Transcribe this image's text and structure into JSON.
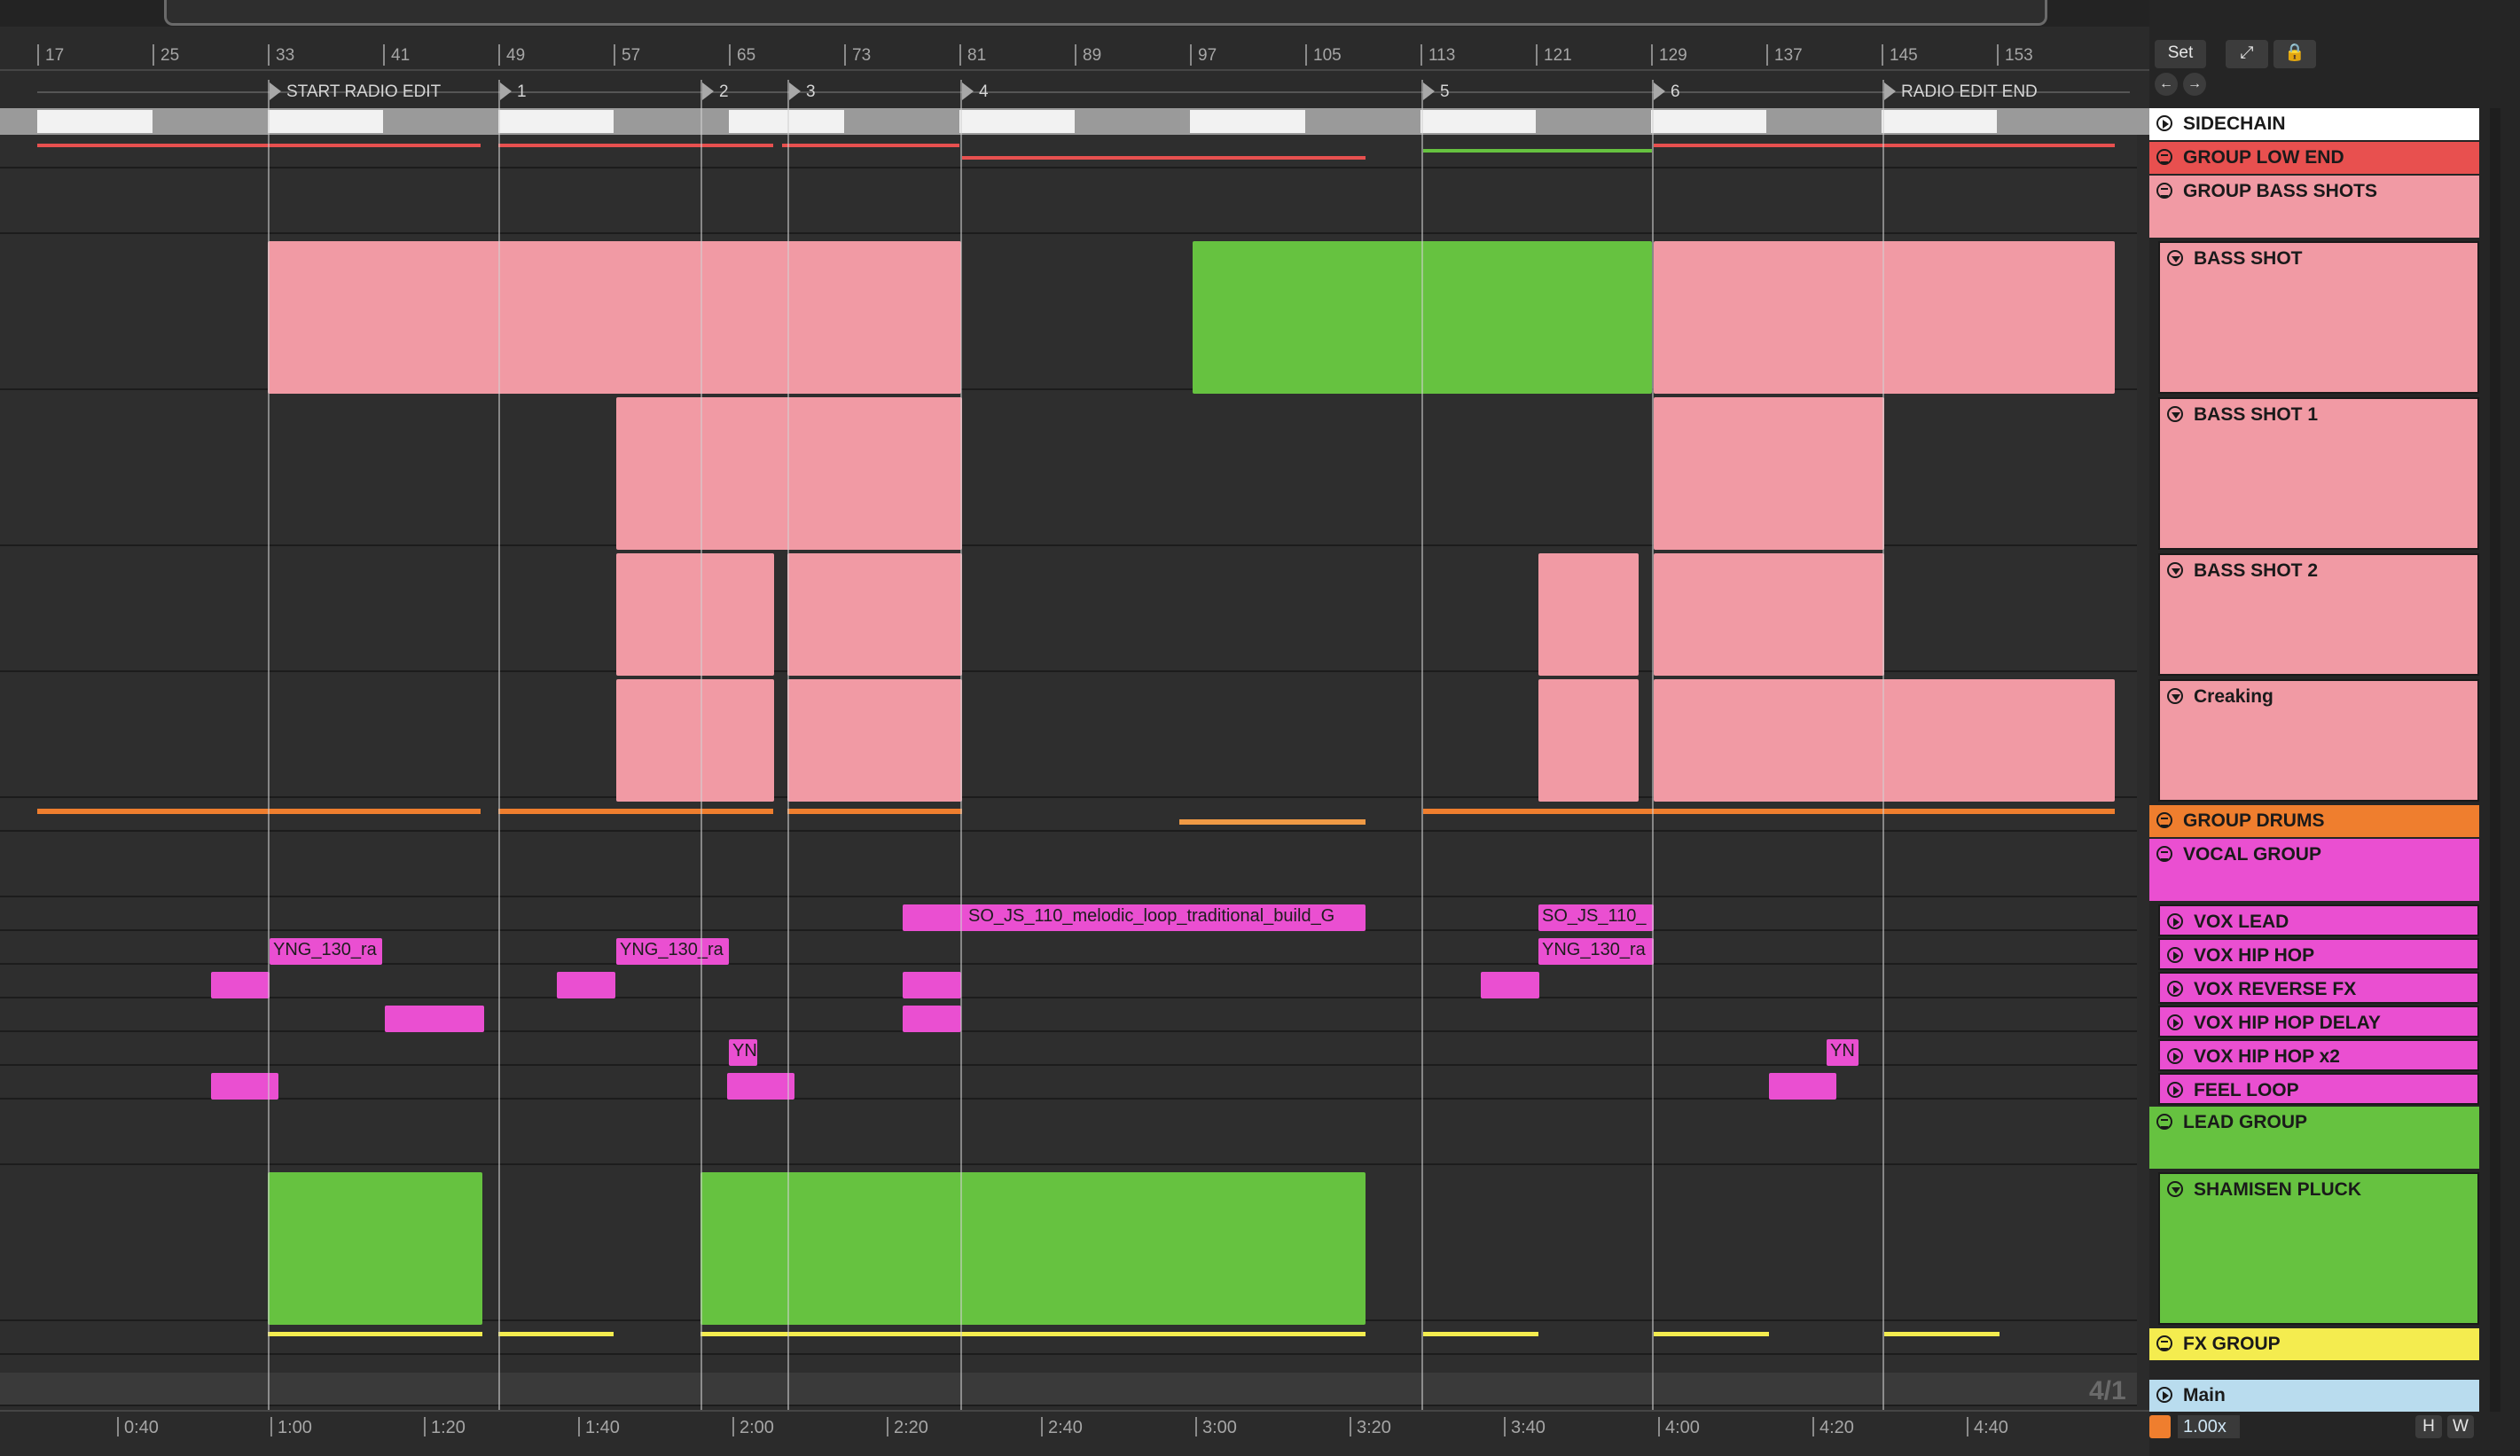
{
  "bar_numbers": [
    "17",
    "25",
    "33",
    "41",
    "49",
    "57",
    "65",
    "73",
    "81",
    "89",
    "97",
    "105",
    "113",
    "121",
    "129",
    "137",
    "145",
    "153"
  ],
  "locators": [
    "START RADIO EDIT",
    "1",
    "2",
    "3",
    "4",
    "5",
    "6",
    "RADIO EDIT END"
  ],
  "time_labels": [
    "0:40",
    "1:00",
    "1:20",
    "1:40",
    "2:00",
    "2:20",
    "2:40",
    "3:00",
    "3:20",
    "3:40",
    "4:00",
    "4:20",
    "4:40"
  ],
  "top_controls": {
    "set_label": "Set",
    "expand_icon": "expand-icon",
    "lock_icon": "lock-icon",
    "prev_icon": "back-arrow-icon",
    "next_icon": "forward-arrow-icon"
  },
  "tracks": [
    {
      "name": "SIDECHAIN",
      "icon": "play-icon",
      "color": "#ffffff"
    },
    {
      "name": "GROUP LOW END",
      "icon": "group-icon",
      "color": "#e8504f"
    },
    {
      "name": "GROUP BASS SHOTS",
      "icon": "group-icon",
      "color": "#f19aa4"
    },
    {
      "name": "BASS SHOT",
      "icon": "chevron-down-icon",
      "color": "#f19aa4"
    },
    {
      "name": "BASS SHOT 1",
      "icon": "chevron-down-icon",
      "color": "#f19aa4"
    },
    {
      "name": "BASS SHOT 2",
      "icon": "chevron-down-icon",
      "color": "#f19aa4"
    },
    {
      "name": "Creaking",
      "icon": "chevron-down-icon",
      "color": "#f19aa4"
    },
    {
      "name": "GROUP DRUMS",
      "icon": "group-icon",
      "color": "#ef7e2e"
    },
    {
      "name": "VOCAL GROUP",
      "icon": "group-icon",
      "color": "#ea4fd1"
    },
    {
      "name": "VOX LEAD",
      "icon": "play-icon",
      "color": "#ea4fd1"
    },
    {
      "name": "VOX HIP HOP",
      "icon": "play-icon",
      "color": "#ea4fd1"
    },
    {
      "name": "VOX REVERSE FX",
      "icon": "play-icon",
      "color": "#ea4fd1"
    },
    {
      "name": "VOX HIP HOP DELAY",
      "icon": "play-icon",
      "color": "#ea4fd1"
    },
    {
      "name": "VOX HIP HOP x2",
      "icon": "play-icon",
      "color": "#ea4fd1"
    },
    {
      "name": "FEEL LOOP",
      "icon": "play-icon",
      "color": "#ea4fd1"
    },
    {
      "name": "LEAD GROUP",
      "icon": "group-icon",
      "color": "#66c240"
    },
    {
      "name": "SHAMISEN PLUCK",
      "icon": "chevron-down-icon",
      "color": "#66c240"
    },
    {
      "name": "FX GROUP",
      "icon": "group-icon",
      "color": "#f4ec4f"
    }
  ],
  "main_track": {
    "name": "Main",
    "icon": "play-icon",
    "color": "#b9dcee"
  },
  "clip_names": {
    "vox_lead_1": "SO_JS_110_melodic_loop_traditional_build_G",
    "vox_lead_2": "SO_JS_110_",
    "vox_hiphop_1": "YNG_130_ra",
    "vox_hiphop_2": "YNG_130_ra",
    "vox_hiphop_3": "YNG_130_ra",
    "vox_x2_1": "YN",
    "vox_x2_2": "YN"
  },
  "time_signature": "4/1",
  "zoom": "1.00x",
  "bottom_buttons": {
    "h": "H",
    "w": "W"
  },
  "colors": {
    "pink": "#f19aa4",
    "green": "#66c240",
    "magenta": "#ea4fd1",
    "orange": "#ef7e2e",
    "yellow": "#f4ec4f",
    "red": "#e8504f"
  }
}
